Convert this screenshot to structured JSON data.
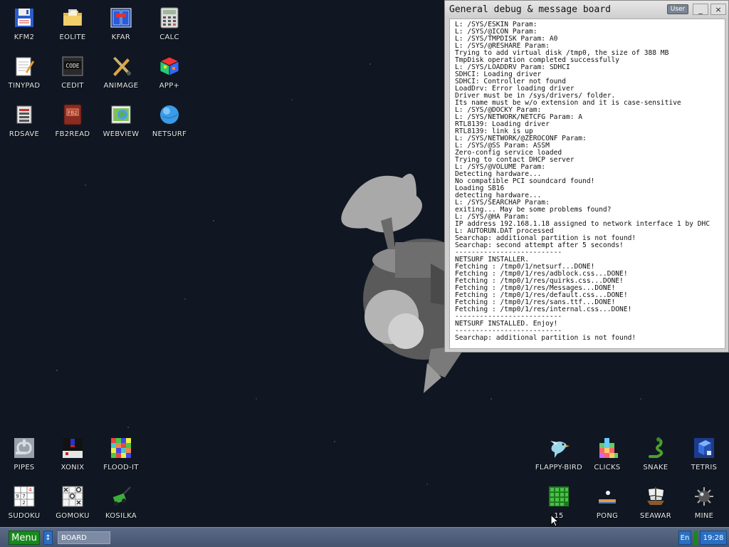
{
  "desktop": {
    "icons_top": [
      {
        "label": "KFM2",
        "icon": "floppy-disk-icon"
      },
      {
        "label": "EOLITE",
        "icon": "folder-icon"
      },
      {
        "label": "KFAR",
        "icon": "kfar-icon"
      },
      {
        "label": "CALC",
        "icon": "calculator-icon"
      },
      {
        "label": "TINYPAD",
        "icon": "notepad-icon"
      },
      {
        "label": "CEDIT",
        "icon": "code-editor-icon"
      },
      {
        "label": "ANIMAGE",
        "icon": "paint-tools-icon"
      },
      {
        "label": "APP+",
        "icon": "rubiks-cube-icon"
      },
      {
        "label": "RDSAVE",
        "icon": "ramdisk-save-icon"
      },
      {
        "label": "FB2READ",
        "icon": "book-icon"
      },
      {
        "label": "WEBVIEW",
        "icon": "web-page-icon"
      },
      {
        "label": "NETSURF",
        "icon": "globe-icon"
      }
    ],
    "icons_games": [
      {
        "label": "PIPES",
        "icon": "pipes-icon"
      },
      {
        "label": "XONIX",
        "icon": "xonix-icon"
      },
      {
        "label": "FLOOD-IT",
        "icon": "flood-it-icon"
      },
      {
        "label": "SUDOKU",
        "icon": "sudoku-icon"
      },
      {
        "label": "GOMOKU",
        "icon": "gomoku-icon"
      },
      {
        "label": "KOSILKA",
        "icon": "lawn-mower-icon"
      },
      {
        "label": "FLAPPY-BIRD",
        "icon": "bird-icon"
      },
      {
        "label": "CLICKS",
        "icon": "clicks-blocks-icon"
      },
      {
        "label": "SNAKE",
        "icon": "snake-icon"
      },
      {
        "label": "TETRIS",
        "icon": "tetris-icon"
      },
      {
        "label": "15",
        "icon": "fifteen-puzzle-icon"
      },
      {
        "label": "PONG",
        "icon": "pong-icon"
      },
      {
        "label": "SEAWAR",
        "icon": "sailing-ship-icon"
      },
      {
        "label": "MINE",
        "icon": "mine-icon"
      }
    ]
  },
  "board": {
    "title": "General debug & message board",
    "user_button": "User",
    "minimize": "_",
    "close": "×",
    "log_lines": [
      "L: /SYS/ESKIN Param:",
      "L: /SYS/@ICON Param:",
      "L: /SYS/TMPDISK Param: A0",
      "L: /SYS/@RESHARE Param:",
      "Trying to add virtual disk /tmp0, the size of 388 MB",
      "TmpDisk operation completed successfully",
      "L: /SYS/LOADDRV Param: SDHCI",
      "SDHCI: Loading driver",
      "SDHCI: Controller not found",
      "LoadDrv: Error loading driver",
      "Driver must be in /sys/drivers/ folder.",
      "Its name must be w/o extension and it is case-sensitive",
      "L: /SYS/@DOCKY Param:",
      "L: /SYS/NETWORK/NETCFG Param: A",
      "RTL8139: Loading driver",
      "RTL8139: link is up",
      "L: /SYS/NETWORK/@ZEROCONF Param:",
      "L: /SYS/@SS Param: ASSM",
      "Zero-config service loaded",
      "Trying to contact DHCP server",
      "L: /SYS/@VOLUME Param:",
      "Detecting hardware...",
      "No compatible PCI soundcard found!",
      "Loading SB16",
      "detecting hardware...",
      "L: /SYS/SEARCHAP Param:",
      "exiting... May be some problems found?",
      "L: /SYS/@HA Param:",
      "IP address 192.168.1.18 assigned to network interface 1 by DHC",
      "L: AUTORUN.DAT processed",
      "Searchap: additional partition is not found!",
      "Searchap: second attempt after 5 seconds!",
      "--------------------------",
      "NETSURF INSTALLER.",
      "Fetching : /tmp0/1/netsurf...DONE!",
      "Fetching : /tmp0/1/res/adblock.css...DONE!",
      "Fetching : /tmp0/1/res/quirks.css...DONE!",
      "Fetching : /tmp0/1/res/Messages...DONE!",
      "Fetching : /tmp0/1/res/default.css...DONE!",
      "Fetching : /tmp0/1/res/sans.ttf...DONE!",
      "Fetching : /tmp0/1/res/internal.css...DONE!",
      "--------------------------",
      "NETSURF INSTALLED. Enjoy!",
      "--------------------------",
      "Searchap: additional partition is not found!"
    ]
  },
  "taskbar": {
    "menu_label": "Menu",
    "scroll_icon": "↕",
    "task_label": "BOARD",
    "lang": "En",
    "clock": "19:28"
  },
  "colors": {
    "desktop_bg": "#101723",
    "taskbar": "#4f5e7a",
    "menu_green": "#178a1b",
    "tray_blue": "#2a6fc1"
  }
}
